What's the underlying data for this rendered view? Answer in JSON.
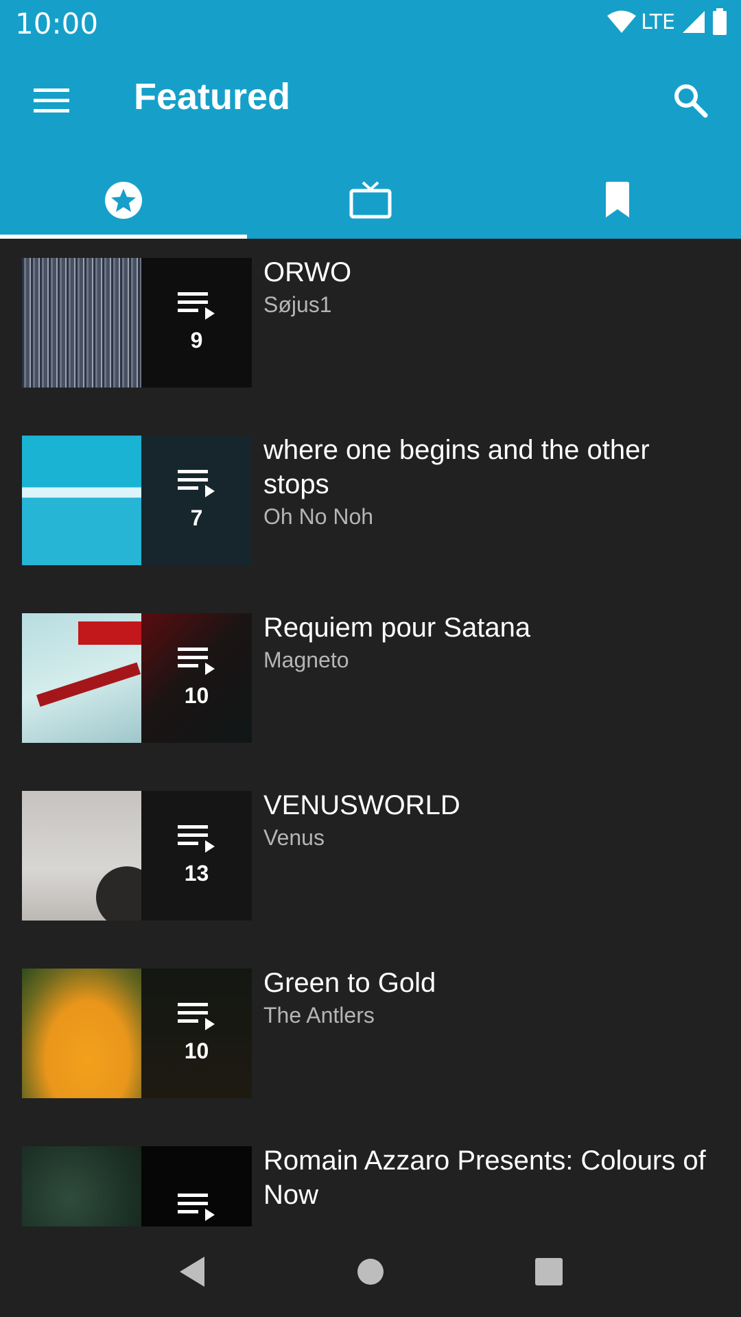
{
  "status_bar": {
    "time": "10:00",
    "network": "LTE",
    "icons": [
      "wifi-icon",
      "lte-signal-icon",
      "battery-icon"
    ]
  },
  "app_bar": {
    "title": "Featured",
    "menu_icon": "menu-icon",
    "search_icon": "search-icon"
  },
  "tabs": [
    {
      "icon": "star-circle-icon",
      "active": true
    },
    {
      "icon": "tv-icon",
      "active": false
    },
    {
      "icon": "bookmark-icon",
      "active": false
    }
  ],
  "playlists": [
    {
      "title": "ORWO",
      "artist": "Søjus1",
      "count": "9"
    },
    {
      "title": "where one begins and the other stops",
      "artist": "Oh No Noh",
      "count": "7"
    },
    {
      "title": "Requiem pour Satana",
      "artist": "Magneto",
      "count": "10"
    },
    {
      "title": "VENUSWORLD",
      "artist": "Venus",
      "count": "13"
    },
    {
      "title": "Green to Gold",
      "artist": "The Antlers",
      "count": "10"
    },
    {
      "title": "Romain Azzaro Presents: Colours of Now",
      "artist": "",
      "count": ""
    }
  ],
  "nav_bar": [
    "back-icon",
    "home-icon",
    "recents-icon"
  ],
  "colors": {
    "primary": "#16a0c9",
    "background": "#212121",
    "subtitle": "#b5b5b5"
  }
}
